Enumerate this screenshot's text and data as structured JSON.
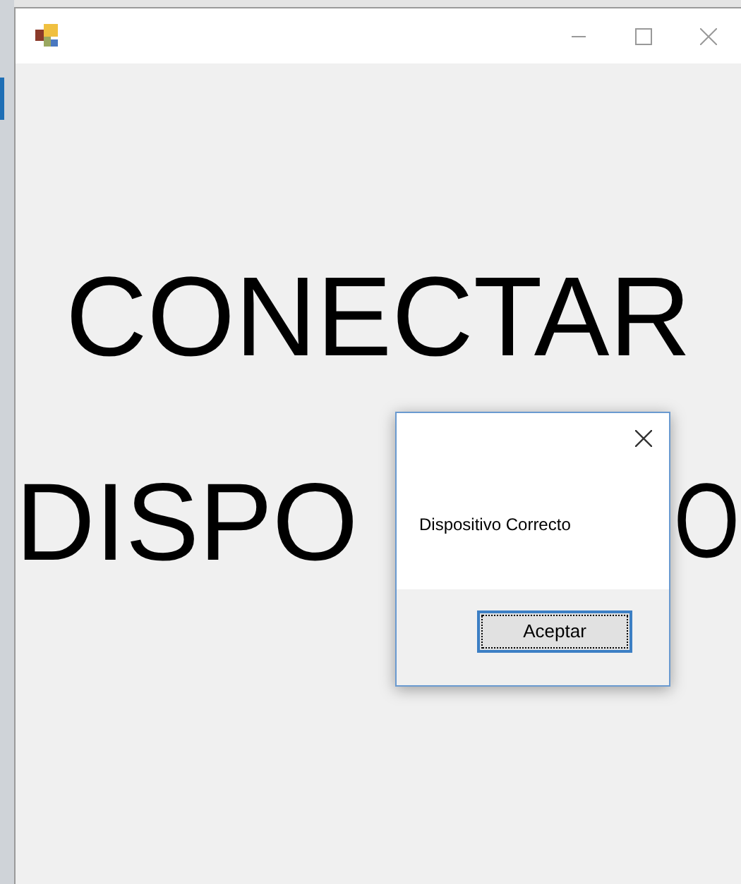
{
  "window": {
    "heading_line_1": "CONECTAR",
    "heading_line_2_left": "DISPO",
    "heading_line_2_right": "O"
  },
  "message_box": {
    "message": "Dispositivo Correcto",
    "button": "Aceptar"
  }
}
